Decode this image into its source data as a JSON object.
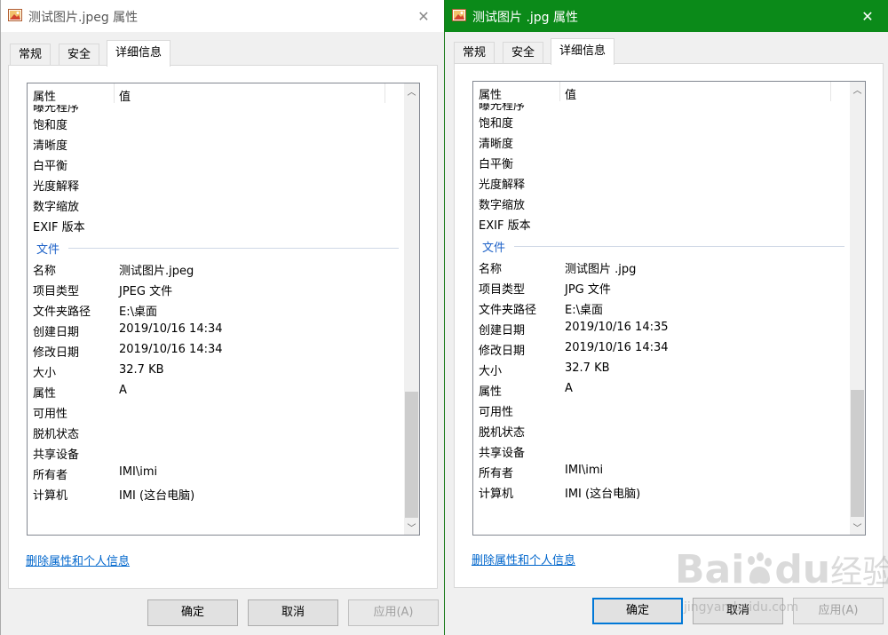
{
  "left": {
    "title": "测试图片.jpeg 属性",
    "tabs": [
      "常规",
      "安全",
      "详细信息"
    ],
    "header": {
      "property": "属性",
      "value": "值"
    },
    "top_rows": [
      "曝光程序",
      "饱和度",
      "清晰度",
      "白平衡",
      "光度解释",
      "数字缩放",
      "EXIF 版本"
    ],
    "group_label": "文件",
    "file_rows": [
      {
        "k": "名称",
        "v": "测试图片.jpeg"
      },
      {
        "k": "项目类型",
        "v": "JPEG 文件"
      },
      {
        "k": "文件夹路径",
        "v": "E:\\桌面"
      },
      {
        "k": "创建日期",
        "v": "2019/10/16 14:34"
      },
      {
        "k": "修改日期",
        "v": "2019/10/16 14:34"
      },
      {
        "k": "大小",
        "v": "32.7 KB"
      },
      {
        "k": "属性",
        "v": "A"
      },
      {
        "k": "可用性",
        "v": ""
      },
      {
        "k": "脱机状态",
        "v": ""
      },
      {
        "k": "共享设备",
        "v": ""
      },
      {
        "k": "所有者",
        "v": "IMI\\imi"
      },
      {
        "k": "计算机",
        "v": "IMI (这台电脑)"
      }
    ],
    "remove_link": "删除属性和个人信息",
    "buttons": {
      "ok": "确定",
      "cancel": "取消",
      "apply": "应用(A)"
    }
  },
  "right": {
    "title": "测试图片 .jpg 属性",
    "tabs": [
      "常规",
      "安全",
      "详细信息"
    ],
    "header": {
      "property": "属性",
      "value": "值"
    },
    "top_rows": [
      "曝光程序",
      "饱和度",
      "清晰度",
      "白平衡",
      "光度解释",
      "数字缩放",
      "EXIF 版本"
    ],
    "group_label": "文件",
    "file_rows": [
      {
        "k": "名称",
        "v": "测试图片 .jpg"
      },
      {
        "k": "项目类型",
        "v": "JPG 文件"
      },
      {
        "k": "文件夹路径",
        "v": "E:\\桌面"
      },
      {
        "k": "创建日期",
        "v": "2019/10/16 14:35"
      },
      {
        "k": "修改日期",
        "v": "2019/10/16 14:34"
      },
      {
        "k": "大小",
        "v": "32.7 KB"
      },
      {
        "k": "属性",
        "v": "A"
      },
      {
        "k": "可用性",
        "v": ""
      },
      {
        "k": "脱机状态",
        "v": ""
      },
      {
        "k": "共享设备",
        "v": ""
      },
      {
        "k": "所有者",
        "v": "IMI\\imi"
      },
      {
        "k": "计算机",
        "v": "IMI (这台电脑)"
      }
    ],
    "remove_link": "删除属性和个人信息",
    "buttons": {
      "ok": "确定",
      "cancel": "取消",
      "apply": "应用(A)"
    }
  },
  "watermark": {
    "brand": "Bai",
    "brand2": "du",
    "cn": "经验",
    "url": "jingyan.baidu.com"
  },
  "icons": {
    "close": "close-icon",
    "app": "image-file-icon",
    "scroll_up": "chevron-up-icon",
    "scroll_down": "chevron-down-icon"
  },
  "colors": {
    "active_titlebar": "#0b8a19",
    "link": "#0066cc",
    "group_label": "#1e62c8",
    "default_button_border": "#0078d7"
  }
}
